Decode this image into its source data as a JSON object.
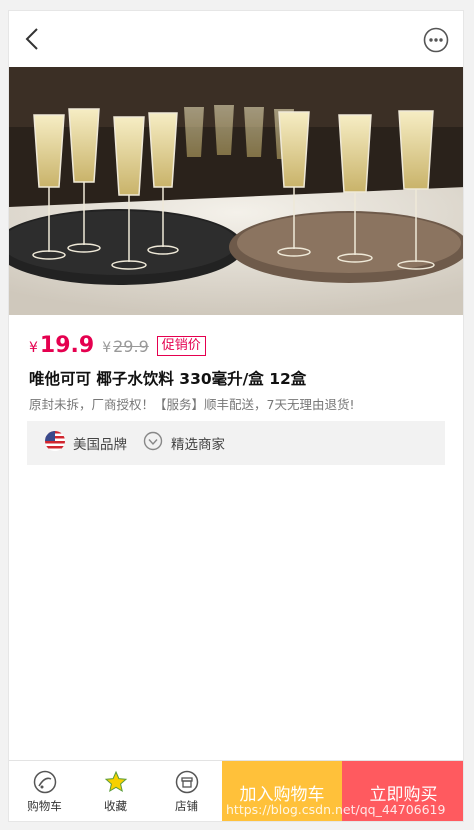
{
  "colors": {
    "price_accent": "#e5004f",
    "add_cart_bg": "#ffc13a",
    "buy_now_bg": "#ff5a5f"
  },
  "header": {
    "back_icon": "chevron-left-icon",
    "more_icon": "more-dots-icon"
  },
  "gallery": {
    "image": "champagne-glasses-photo",
    "slide_count": 4,
    "active_slide": 1
  },
  "product": {
    "currency": "¥",
    "price": "19.9",
    "orig_currency": "¥",
    "orig_price": "29.9",
    "promo_tag": "促销价",
    "title": "唯他可可 椰子水饮料 330毫升/盒 12盒",
    "subtitle": "原封未拆，厂商授权！【服务】顺丰配送，7天无理由退货!",
    "badges": [
      {
        "icon": "us-flag-icon",
        "label": "美国品牌"
      },
      {
        "icon": "check-circle-icon",
        "label": "精选商家"
      }
    ]
  },
  "bottom_bar": {
    "cart_label": "购物车",
    "favorite_label": "收藏",
    "shop_label": "店铺",
    "add_to_cart": "加入购物车",
    "buy_now": "立即购买"
  },
  "watermark": "https://blog.csdn.net/qq_44706619"
}
